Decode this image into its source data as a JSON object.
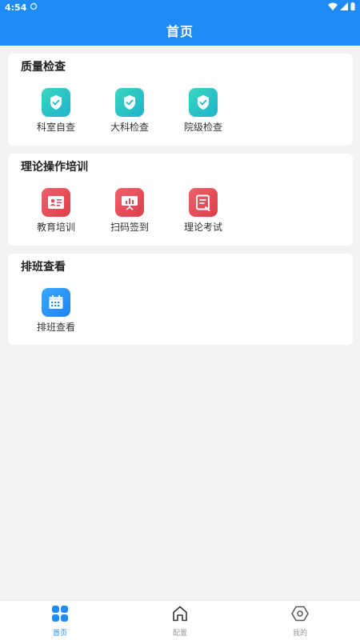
{
  "status": {
    "time": "4:54"
  },
  "header": {
    "title": "首页"
  },
  "sections": [
    {
      "title": "质量检查",
      "items": [
        {
          "label": "科室自查",
          "icon": "shield-check-icon",
          "color": "#2ec4c6"
        },
        {
          "label": "大科检查",
          "icon": "shield-check-icon",
          "color": "#2ec4c6"
        },
        {
          "label": "院级检查",
          "icon": "shield-check-icon",
          "color": "#2ec4c6"
        }
      ]
    },
    {
      "title": "理论操作培训",
      "items": [
        {
          "label": "教育培训",
          "icon": "id-card-icon",
          "color": "#e44a55"
        },
        {
          "label": "扫码签到",
          "icon": "presentation-board-icon",
          "color": "#e44a55"
        },
        {
          "label": "理论考试",
          "icon": "exam-paper-icon",
          "color": "#e44a55"
        }
      ]
    },
    {
      "title": "排班查看",
      "items": [
        {
          "label": "排班查看",
          "icon": "calendar-icon",
          "color": "#2a95f7"
        }
      ]
    }
  ],
  "tabbar": {
    "tabs": [
      {
        "label": "首页",
        "icon": "grid-icon",
        "active": true
      },
      {
        "label": "配置",
        "icon": "home-icon",
        "active": false
      },
      {
        "label": "我的",
        "icon": "hexagon-icon",
        "active": false
      }
    ]
  },
  "colors": {
    "primary": "#1f8bf5",
    "background": "#f3f3f3"
  }
}
